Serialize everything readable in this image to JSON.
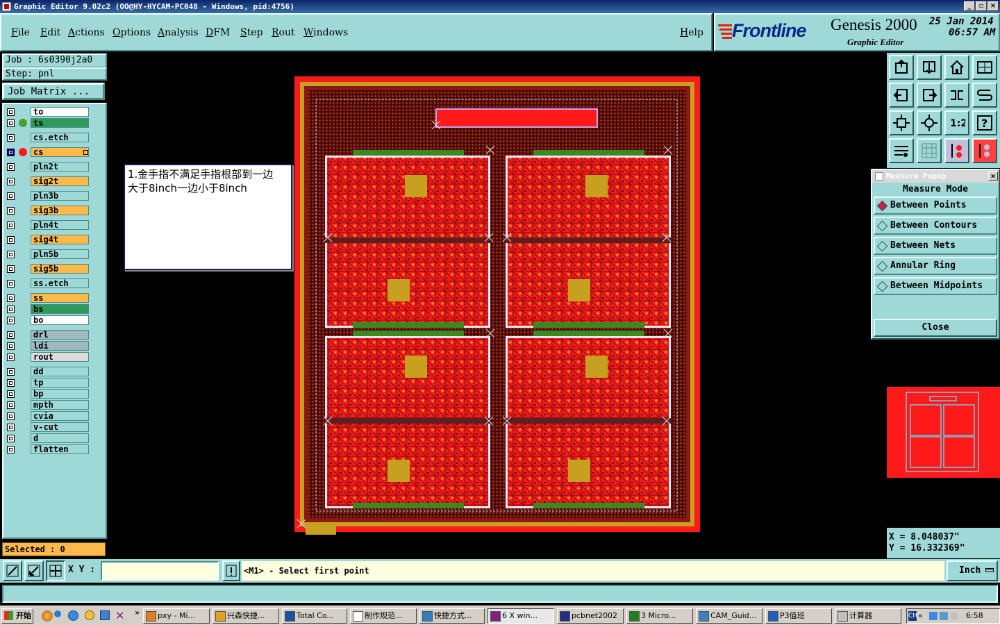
{
  "window": {
    "title": "Graphic Editor 9.02c2  (OO@HY-HYCAM-PC048 - Windows, pid:4756)"
  },
  "menu": [
    "File",
    "Edit",
    "Actions",
    "Options",
    "Analysis",
    "DFM",
    "Step",
    "Rout",
    "Windows"
  ],
  "help_label": "Help",
  "logo": {
    "brand": "Frontline",
    "product": "Genesis 2000",
    "subtitle": "Graphic Editor",
    "date": "25 Jan 2014",
    "time": "06:57 AM"
  },
  "job": {
    "job_label": "Job : 6s0390j2a0",
    "step_label": "Step: pnl",
    "matrix_button": "Job Matrix ..."
  },
  "layers": [
    {
      "name": "to",
      "color": "#ffffff",
      "marker": "",
      "checked": false
    },
    {
      "name": "ts",
      "color": "#2e9a5a",
      "marker": "#48a030",
      "checked": false
    },
    {
      "name": "cs.etch",
      "color": "#9fd9d7",
      "marker": "",
      "checked": false
    },
    {
      "name": "cs",
      "color": "#ffb84a",
      "marker": "#ff1a1a",
      "checked": true
    },
    {
      "name": "pln2t",
      "color": "#9fd9d7",
      "marker": "",
      "checked": false
    },
    {
      "name": "sig2t",
      "color": "#ffb84a",
      "marker": "",
      "checked": false
    },
    {
      "name": "pln3b",
      "color": "#9fd9d7",
      "marker": "",
      "checked": false
    },
    {
      "name": "sig3b",
      "color": "#ffb84a",
      "marker": "",
      "checked": false
    },
    {
      "name": "pln4t",
      "color": "#9fd9d7",
      "marker": "",
      "checked": false
    },
    {
      "name": "sig4t",
      "color": "#ffb84a",
      "marker": "",
      "checked": false
    },
    {
      "name": "pln5b",
      "color": "#9fd9d7",
      "marker": "",
      "checked": false
    },
    {
      "name": "sig5b",
      "color": "#ffb84a",
      "marker": "",
      "checked": false
    },
    {
      "name": "ss.etch",
      "color": "#9fd9d7",
      "marker": "",
      "checked": false
    },
    {
      "name": "ss",
      "color": "#ffb84a",
      "marker": "",
      "checked": false
    },
    {
      "name": "bs",
      "color": "#2e9a5a",
      "marker": "",
      "checked": false
    },
    {
      "name": "bo",
      "color": "#ffffff",
      "marker": "",
      "checked": false
    },
    {
      "name": "drl",
      "color": "#a0b8c0",
      "marker": "",
      "checked": false
    },
    {
      "name": "ldi",
      "color": "#a0b8c0",
      "marker": "",
      "checked": false
    },
    {
      "name": "rout",
      "color": "#dcdcdc",
      "marker": "",
      "checked": false
    },
    {
      "name": "dd",
      "color": "#9fd9d7",
      "marker": "",
      "checked": false
    },
    {
      "name": "tp",
      "color": "#9fd9d7",
      "marker": "",
      "checked": false
    },
    {
      "name": "bp",
      "color": "#9fd9d7",
      "marker": "",
      "checked": false
    },
    {
      "name": "mpth",
      "color": "#9fd9d7",
      "marker": "",
      "checked": false
    },
    {
      "name": "cvia",
      "color": "#9fd9d7",
      "marker": "",
      "checked": false
    },
    {
      "name": "v-cut",
      "color": "#9fd9d7",
      "marker": "",
      "checked": false
    },
    {
      "name": "d",
      "color": "#9fd9d7",
      "marker": "",
      "checked": false
    },
    {
      "name": "flatten",
      "color": "#9fd9d7",
      "marker": "",
      "checked": false
    }
  ],
  "selected_label": "Selected : 0",
  "annotation": {
    "line1": "1.金手指不满足手指根部到一边",
    "line2": "大于8inch一边小于8inch"
  },
  "measure_popup": {
    "title": "Measure Popup",
    "mode_label": "Measure Mode",
    "options": [
      {
        "label": "Between Points",
        "selected": true
      },
      {
        "label": "Between Contours",
        "selected": false
      },
      {
        "label": "Between Nets",
        "selected": false
      },
      {
        "label": "Annular Ring",
        "selected": false
      },
      {
        "label": "Between Midpoints",
        "selected": false
      }
    ],
    "close_label": "Close"
  },
  "coords": {
    "x": "X  =  8.048037\"",
    "y": "Y  =  16.332369\""
  },
  "statusbar": {
    "xy_label": "X Y :",
    "xy_value": "",
    "prompt": "<M1> - Select first point",
    "units": "Inch"
  },
  "taskbar": {
    "start": "开始",
    "tasks": [
      {
        "label": "pxy - Mi..."
      },
      {
        "label": "兴森快捷..."
      },
      {
        "label": "Total Co..."
      },
      {
        "label": "制作规范..."
      },
      {
        "label": "快捷方式..."
      },
      {
        "label": "6 X win..."
      },
      {
        "label": "pcbnet2002"
      },
      {
        "label": "3 Micro..."
      },
      {
        "label": "CAM_Guid..."
      },
      {
        "label": "P3值班"
      },
      {
        "label": "计算器"
      }
    ],
    "clock": "6:58",
    "tray_label": "CH"
  },
  "colors": {
    "panel": "#9fd9d7",
    "board": "#ff1a1a",
    "copper": "#c8a020"
  }
}
